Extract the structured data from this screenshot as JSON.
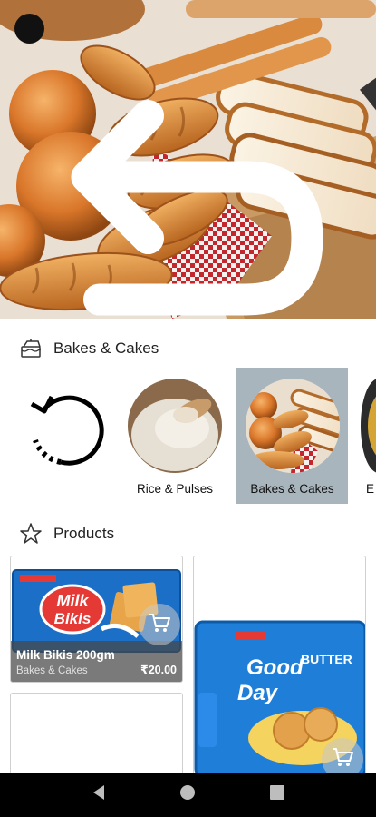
{
  "section_categories": {
    "title": "Bakes & Cakes",
    "icon": "cake-icon"
  },
  "categories": [
    {
      "label": "",
      "icon": "refresh-icon"
    },
    {
      "label": "Rice & Pulses",
      "icon": "rice-image"
    },
    {
      "label": "Bakes & Cakes",
      "icon": "bread-image",
      "selected": true
    },
    {
      "label": "E",
      "icon": "partial-category"
    }
  ],
  "section_products": {
    "title": "Products",
    "icon": "star-icon"
  },
  "products": [
    {
      "name": "Milk Bikis 200gm",
      "category": "Bakes & Cakes",
      "price": "₹20.00",
      "package_brand": "Milk Bikis"
    },
    {
      "name": "",
      "package_brand": "Good Day",
      "package_sub": "BUTTER"
    },
    {
      "name": ""
    }
  ],
  "colors": {
    "accent_selected": "#a9b5bd",
    "navbar": "#000000",
    "overlay": "#464646"
  }
}
